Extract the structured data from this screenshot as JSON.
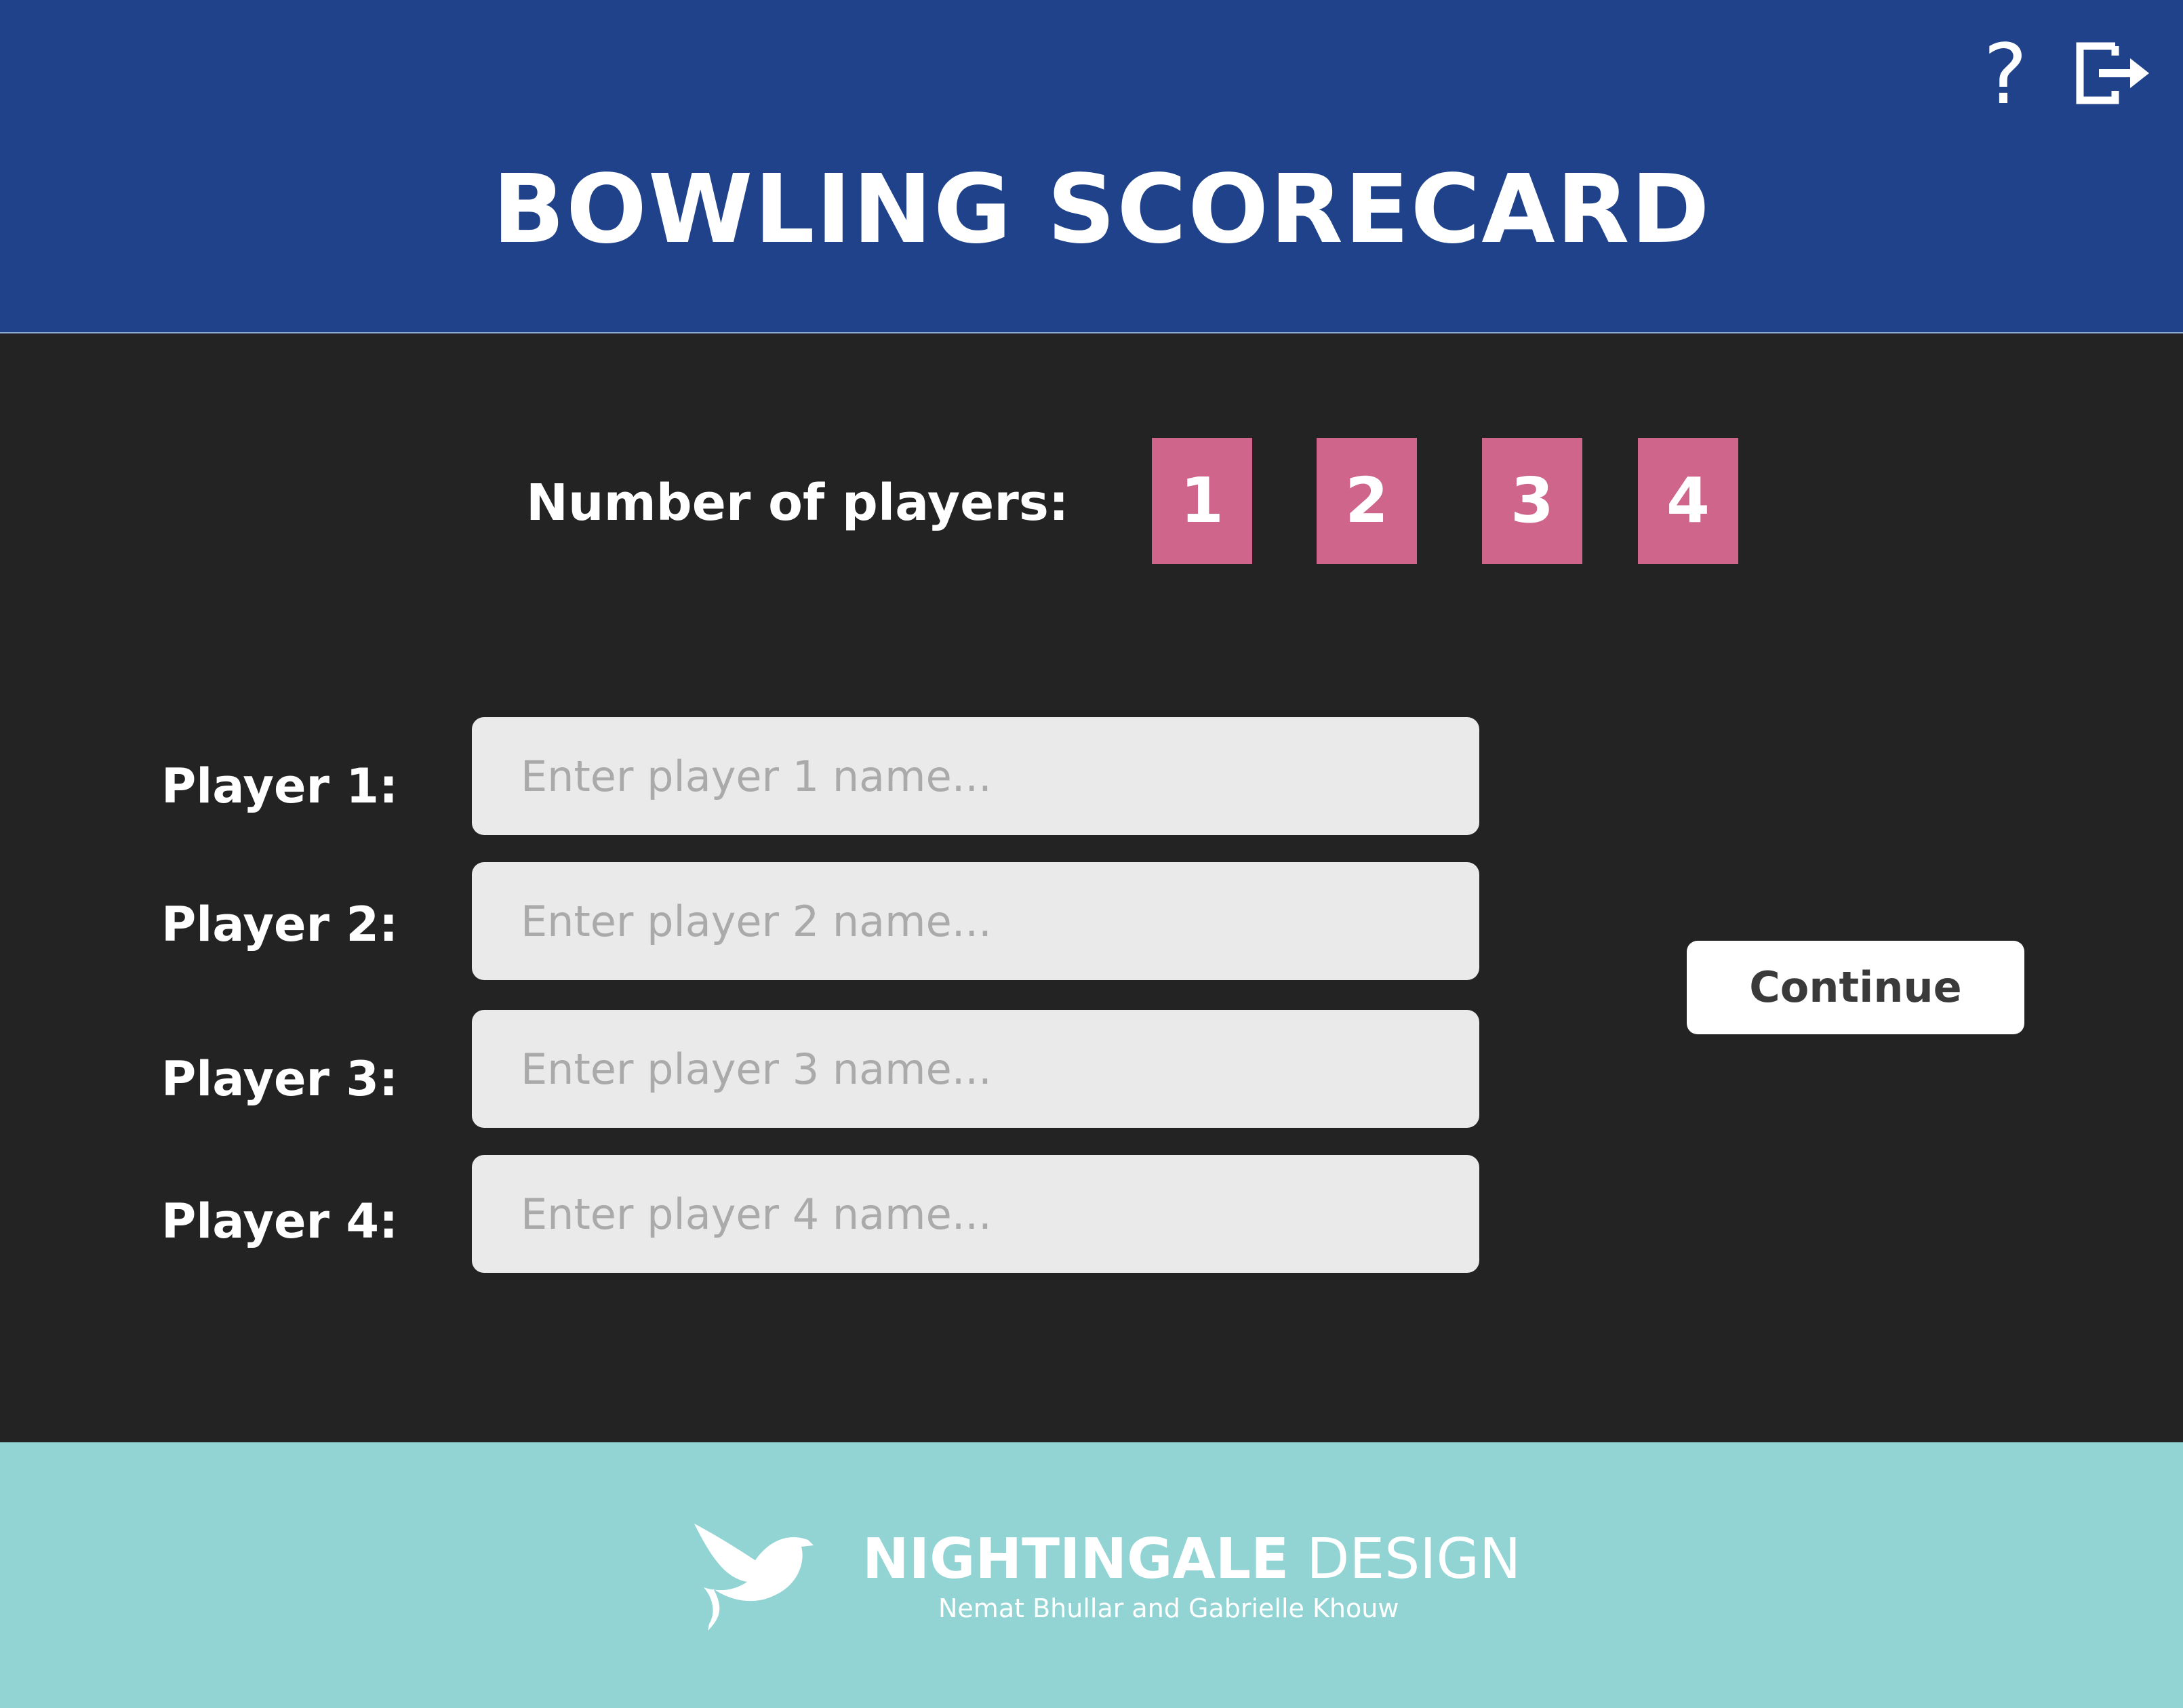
{
  "header": {
    "title": "BOWLING SCORECARD",
    "help_label": "?",
    "exit_icon": "exit-icon"
  },
  "player_count": {
    "label": "Number of players:",
    "options": [
      "1",
      "2",
      "3",
      "4"
    ]
  },
  "players": [
    {
      "label": "Player 1:",
      "placeholder": "Enter player 1 name...",
      "value": ""
    },
    {
      "label": "Player 2:",
      "placeholder": "Enter player 2 name...",
      "value": ""
    },
    {
      "label": "Player 3:",
      "placeholder": "Enter player 3 name...",
      "value": ""
    },
    {
      "label": "Player 4:",
      "placeholder": "Enter player 4 name...",
      "value": ""
    }
  ],
  "continue_label": "Continue",
  "footer": {
    "logo_icon": "nightingale-bird-icon",
    "brand_strong": "NIGHTINGALE",
    "brand_light": "DESIGN",
    "credits": "Nemat Bhullar and Gabrielle Khouw"
  },
  "colors": {
    "header_bg": "#1f428a",
    "body_bg": "#232323",
    "count_button": "#d0658c",
    "input_bg": "#eaeaea",
    "footer_bg": "#92d4d4"
  }
}
